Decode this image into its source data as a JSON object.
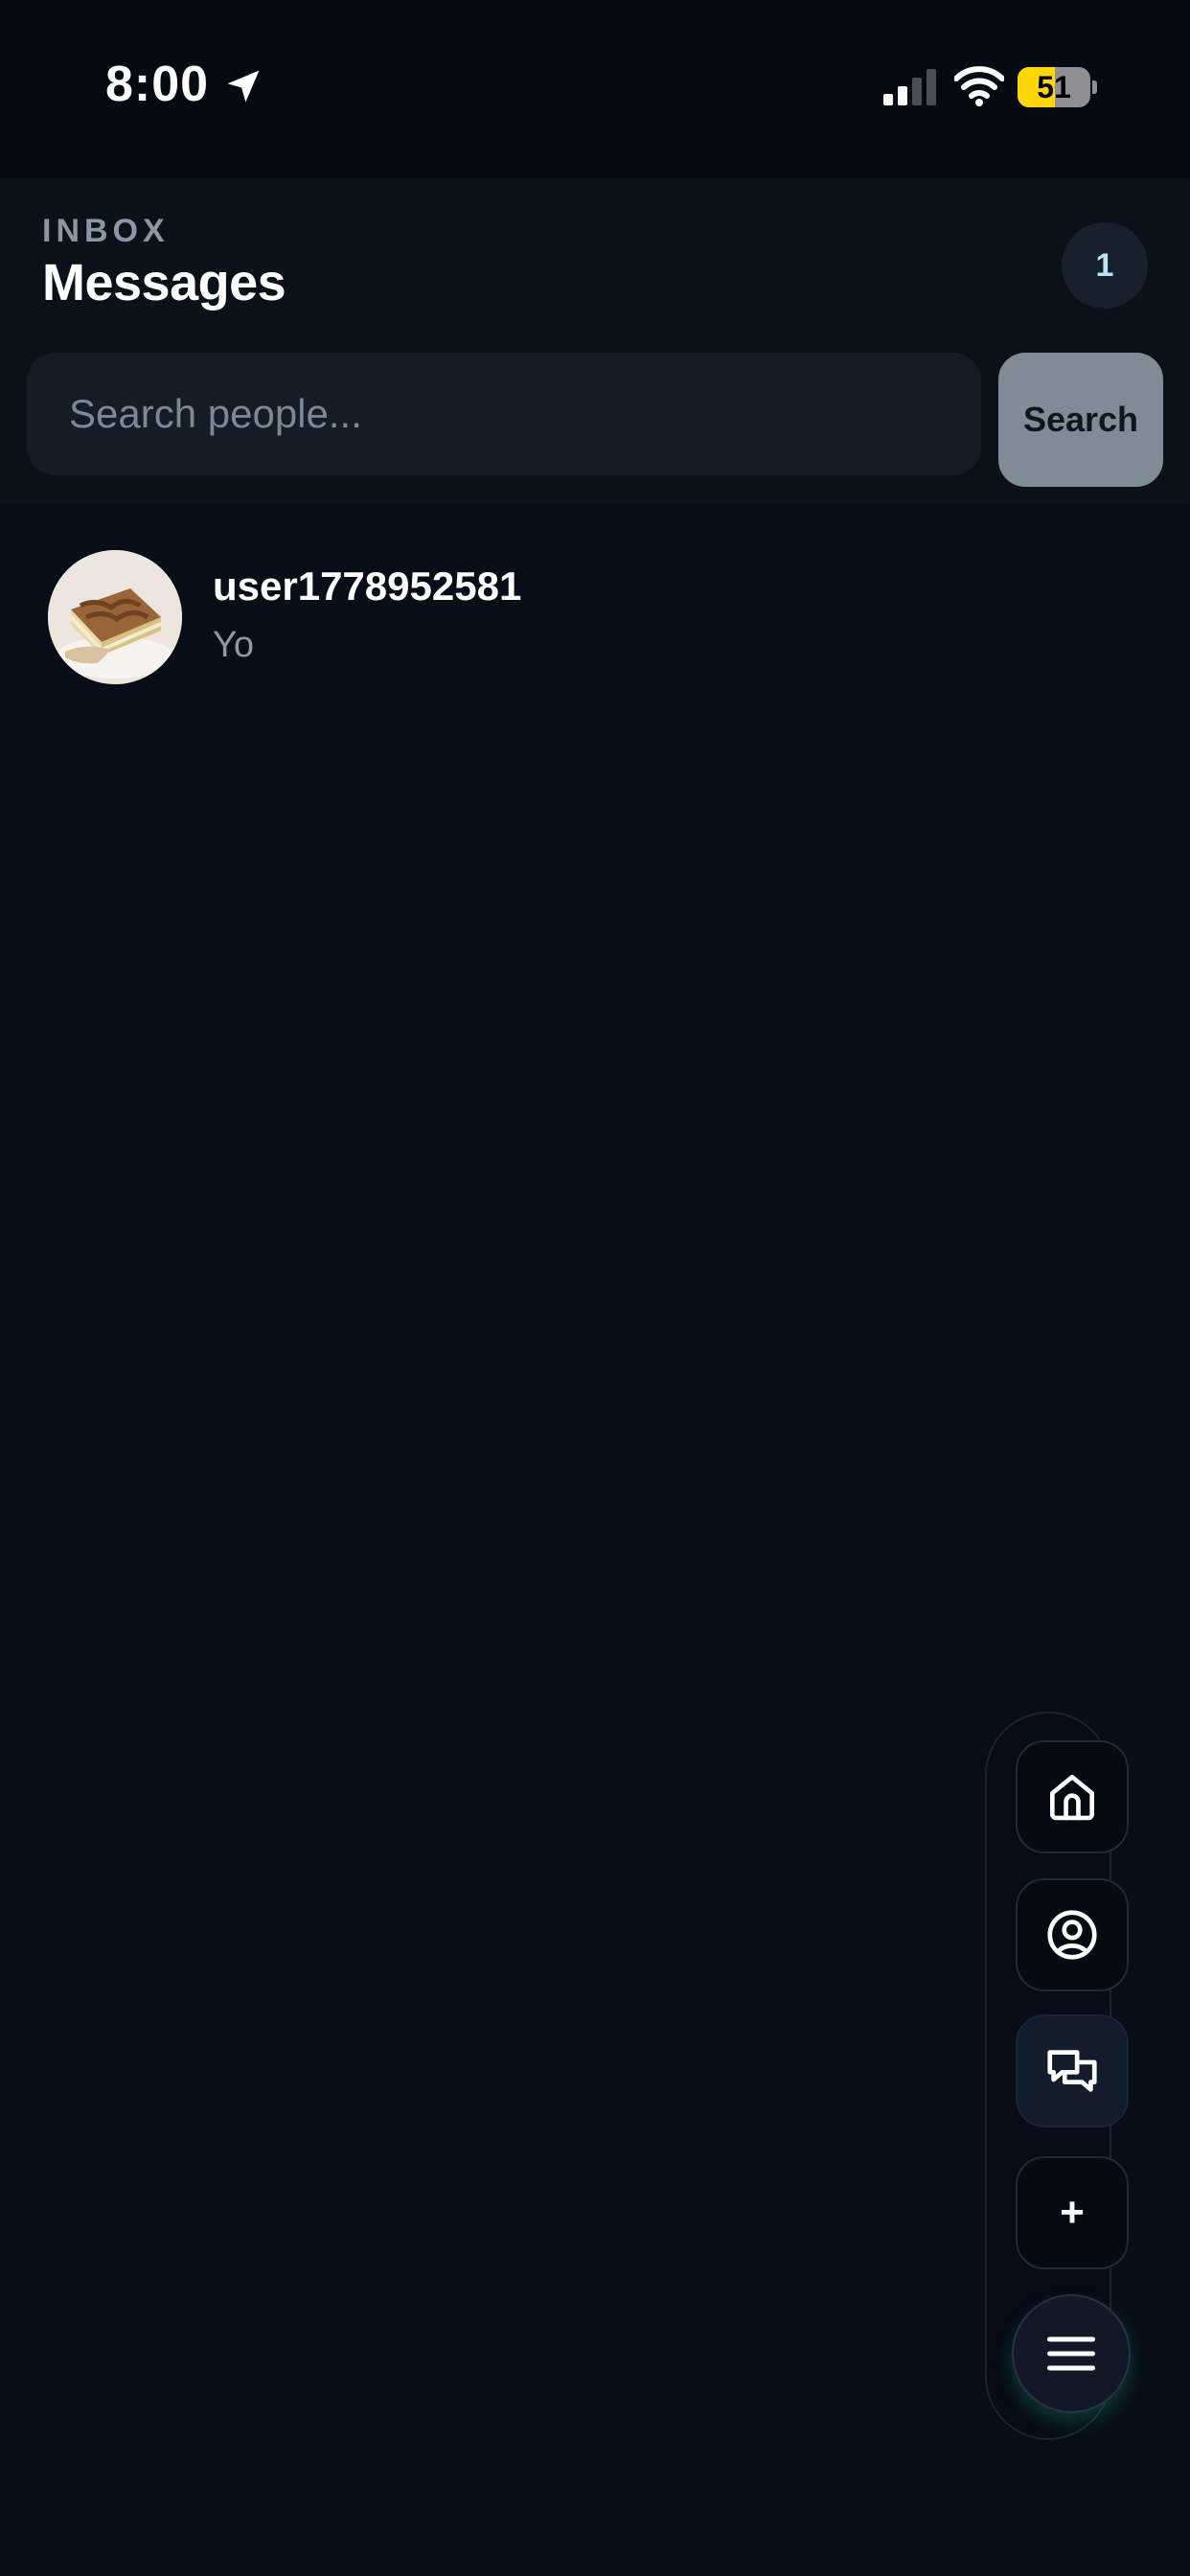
{
  "status_bar": {
    "time": "8:00",
    "battery": "51",
    "battery_fraction": 0.51,
    "icons": [
      "location-arrow-icon",
      "cellular-signal-icon",
      "wifi-icon",
      "battery-icon"
    ]
  },
  "header": {
    "eyebrow": "INBOX",
    "title": "Messages",
    "count": "1"
  },
  "search": {
    "placeholder": "Search people...",
    "value": "",
    "button_label": "Search"
  },
  "conversations": [
    {
      "name": "user1778952581",
      "preview": "Yo",
      "avatar": "dessert-photo-avatar"
    }
  ],
  "dock": {
    "items": [
      {
        "icon": "home-icon",
        "active": false
      },
      {
        "icon": "profile-icon",
        "active": false
      },
      {
        "icon": "chat-bubbles-icon",
        "active": true
      },
      {
        "icon": "plus-icon",
        "label": "+",
        "active": false
      }
    ],
    "menu_icon": "hamburger-menu-icon"
  },
  "colors": {
    "background": "#080e17",
    "header_background": "#0a1119",
    "search_field": "#141c26",
    "search_button": "#7f8b95",
    "badge_background": "#16212c",
    "muted_text": "#8c98a6",
    "battery_fill": "#ffd60a"
  }
}
